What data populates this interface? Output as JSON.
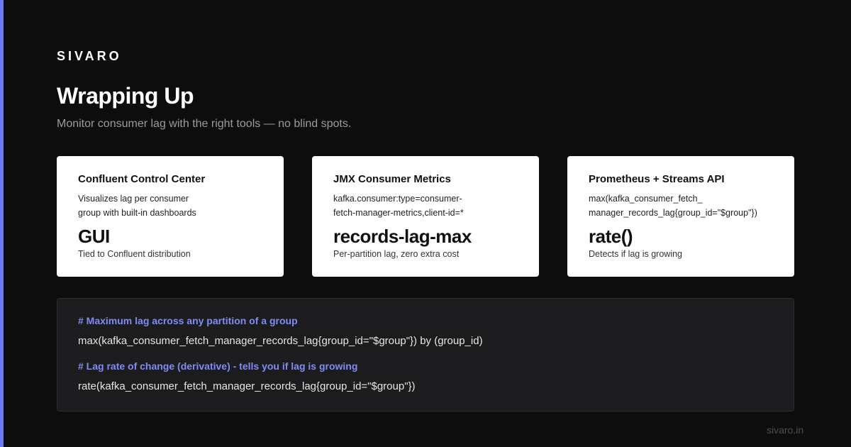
{
  "brand": "SIVARO",
  "title": "Wrapping Up",
  "subtitle": "Monitor consumer lag with the right tools — no blind spots.",
  "cards": [
    {
      "title": "Confluent Control Center",
      "desc_line1": "Visualizes lag per consumer",
      "desc_line2": "group with built-in dashboards",
      "value": "GUI",
      "note": "Tied to Confluent distribution"
    },
    {
      "title": "JMX Consumer Metrics",
      "desc_line1": "kafka.consumer:type=consumer-",
      "desc_line2": "fetch-manager-metrics,client-id=*",
      "value": "records-lag-max",
      "note": "Per-partition lag, zero extra cost"
    },
    {
      "title": "Prometheus + Streams API",
      "desc_line1": "max(kafka_consumer_fetch_",
      "desc_line2": "manager_records_lag{group_id=\"$group\"})",
      "value": "rate()",
      "note": "Detects if lag is growing"
    }
  ],
  "code": {
    "comment1": "# Maximum lag across any partition of a group",
    "line1": "max(kafka_consumer_fetch_manager_records_lag{group_id=\"$group\"}) by (group_id)",
    "comment2": "# Lag rate of change (derivative) - tells you if lag is growing",
    "line2": "rate(kafka_consumer_fetch_manager_records_lag{group_id=\"$group\"})"
  },
  "footer": "sivaro.in",
  "colors": {
    "background": "#0d0d0d",
    "accent": "#6c7bf2",
    "comment": "#7f8cf5"
  }
}
